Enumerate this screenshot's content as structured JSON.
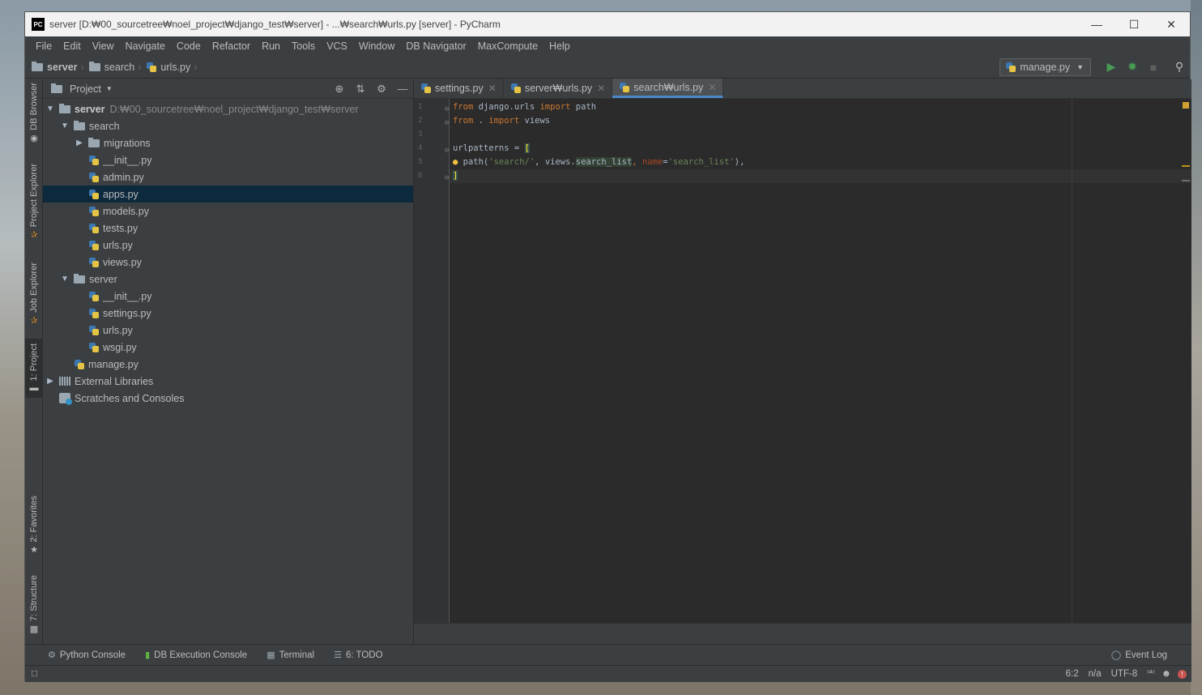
{
  "window": {
    "title": "server [D:₩00_sourcetree₩noel_project₩django_test₩server] - ...₩search₩urls.py [server] - PyCharm",
    "app_icon": "PC"
  },
  "menu": [
    "File",
    "Edit",
    "View",
    "Navigate",
    "Code",
    "Refactor",
    "Run",
    "Tools",
    "VCS",
    "Window",
    "DB Navigator",
    "MaxCompute",
    "Help"
  ],
  "breadcrumbs": [
    "server",
    "search",
    "urls.py"
  ],
  "run_config": "manage.py",
  "left_strip": [
    "DB Browser",
    "Project Explorer",
    "Job Explorer",
    "1: Project",
    "2: Favorites",
    "7: Structure"
  ],
  "project": {
    "title": "Project",
    "tree": [
      {
        "label": "server",
        "path": "D:₩00_sourcetree₩noel_project₩django_test₩server"
      },
      {
        "label": "search"
      },
      {
        "label": "migrations"
      },
      {
        "label": "__init__.py"
      },
      {
        "label": "admin.py"
      },
      {
        "label": "apps.py"
      },
      {
        "label": "models.py"
      },
      {
        "label": "tests.py"
      },
      {
        "label": "urls.py"
      },
      {
        "label": "views.py"
      },
      {
        "label": "server"
      },
      {
        "label": "__init__.py"
      },
      {
        "label": "settings.py"
      },
      {
        "label": "urls.py"
      },
      {
        "label": "wsgi.py"
      },
      {
        "label": "manage.py"
      },
      {
        "label": "External Libraries"
      },
      {
        "label": "Scratches and Consoles"
      }
    ]
  },
  "tabs": [
    {
      "label": "settings.py"
    },
    {
      "label": "server₩urls.py"
    },
    {
      "label": "search₩urls.py"
    }
  ],
  "code": {
    "line_numbers": [
      "1",
      "2",
      "3",
      "4",
      "5",
      "6"
    ],
    "l1": {
      "kw1": "from",
      "mod": " django.urls ",
      "kw2": "import",
      "name": " path"
    },
    "l2": {
      "kw1": "from",
      "mod": " . ",
      "kw2": "import",
      "name": " views"
    },
    "l4": {
      "text": "urlpatterns = ",
      "bracket": "["
    },
    "l5": {
      "pre": " path(",
      "s1": "'search/'",
      "mid": ", views.",
      "ref": "search_list",
      "comma": ", ",
      "param": "name",
      "eq": "=",
      "s2": "'search_list'",
      "end": "),"
    },
    "l6": {
      "bracket": "]"
    }
  },
  "toolwindows": {
    "python_console": "Python Console",
    "db_console": "DB Execution Console",
    "terminal": "Terminal",
    "todo": "6: TODO",
    "event_log": "Event Log"
  },
  "status": {
    "position": "6:2",
    "na": "n/a",
    "encoding": "UTF-8"
  }
}
